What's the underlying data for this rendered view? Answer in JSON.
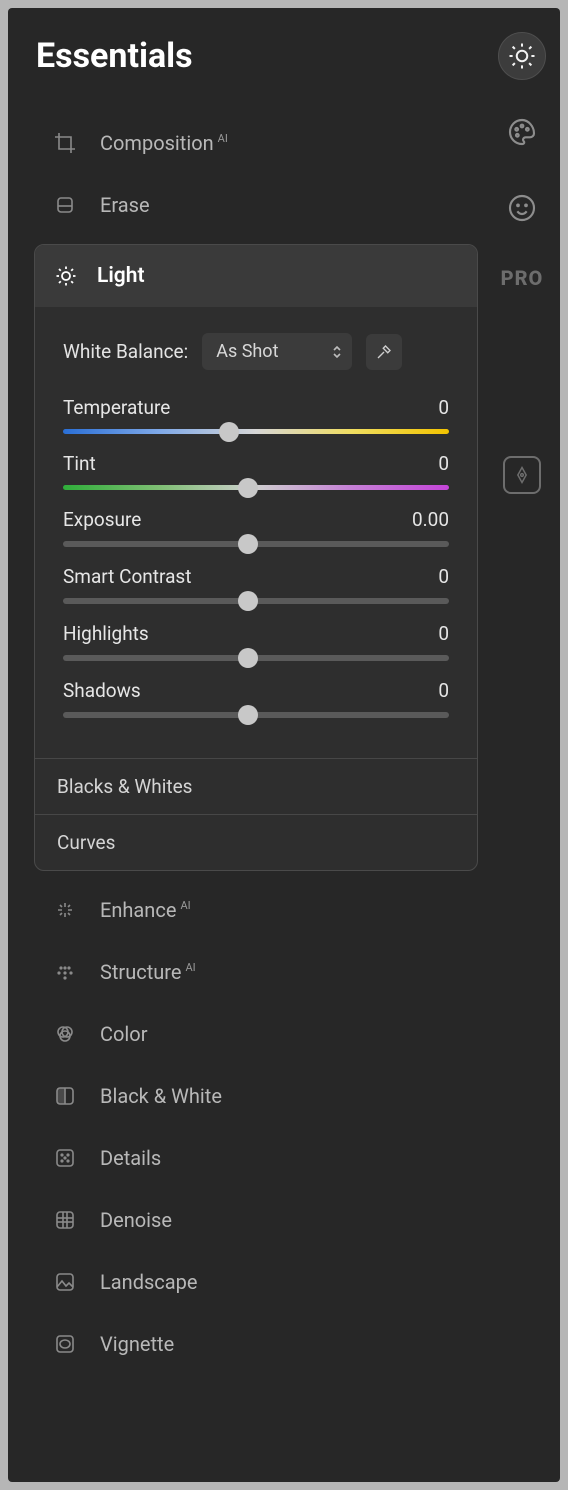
{
  "title": "Essentials",
  "rail": {
    "pro_label": "PRO"
  },
  "tools": {
    "composition": "Composition",
    "erase": "Erase",
    "enhance": "Enhance",
    "structure": "Structure",
    "color": "Color",
    "bw": "Black & White",
    "details": "Details",
    "denoise": "Denoise",
    "landscape": "Landscape",
    "vignette": "Vignette",
    "ai_badge": "AI"
  },
  "light": {
    "heading": "Light",
    "wb_label": "White Balance:",
    "wb_value": "As Shot",
    "sliders": {
      "temperature": {
        "label": "Temperature",
        "value": "0",
        "pos": 0.43
      },
      "tint": {
        "label": "Tint",
        "value": "0",
        "pos": 0.48
      },
      "exposure": {
        "label": "Exposure",
        "value": "0.00",
        "pos": 0.48
      },
      "contrast": {
        "label": "Smart Contrast",
        "value": "0",
        "pos": 0.48
      },
      "highlights": {
        "label": "Highlights",
        "value": "0",
        "pos": 0.48
      },
      "shadows": {
        "label": "Shadows",
        "value": "0",
        "pos": 0.48
      }
    },
    "sub1": "Blacks & Whites",
    "sub2": "Curves"
  }
}
